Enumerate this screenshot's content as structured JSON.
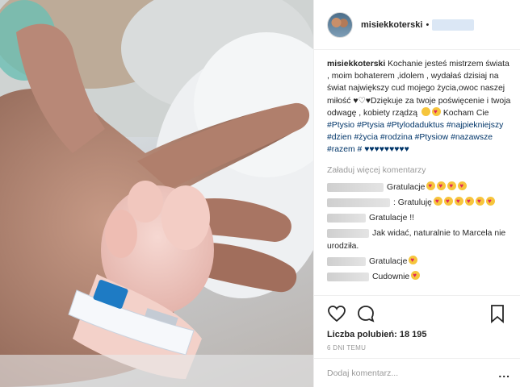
{
  "post": {
    "username": "misiekkoterski",
    "header_dot": "•",
    "caption_pre": "Kochanie jesteś mistrzem świata , moim bohaterem ,idolem , wydałaś dzisiaj na świat największy cud mojego życia,owoc naszej miłość ♥♡♥Dziękuje za twoje poświęcenie i twoja odwagę , kobiety rządzą",
    "caption_mid": " Kocham Cie",
    "hashtags": [
      "#Ptysio",
      "#Ptysia",
      "#Ptylodaduktus",
      "#najpiekniejszy",
      "#dzien",
      "#życia",
      "#rodzina",
      "#Ptysiow",
      "#nazawsze",
      "#razem",
      "#"
    ],
    "hearts": "♥♥♥♥♥♥♥♥♥",
    "load_more": "Załaduj więcej komentarzy",
    "comments": [
      {
        "text": "Gratulacje",
        "emoji_count": 4
      },
      {
        "text": ": Gratuluję",
        "emoji_count": 6
      },
      {
        "text": "Gratulacje !!",
        "emoji_count": 0
      },
      {
        "text": "Jak widać, naturalnie to Marcela nie urodziła.",
        "emoji_count": 0
      },
      {
        "text": "Gratulacje",
        "emoji_count": 1
      },
      {
        "text": "Cudownie",
        "emoji_count": 1
      }
    ],
    "likes_label": "Liczba polubień:",
    "likes_count": "18 195",
    "time_ago": "6 DNI TEMU",
    "comment_placeholder": "Dodaj komentarz...",
    "more_options": "..."
  },
  "icons": {
    "like": "heart-outline-icon",
    "comment": "speech-bubble-icon",
    "save": "bookmark-icon"
  },
  "colors": {
    "hashtag": "#003569",
    "muted": "#999999",
    "text": "#262626"
  }
}
